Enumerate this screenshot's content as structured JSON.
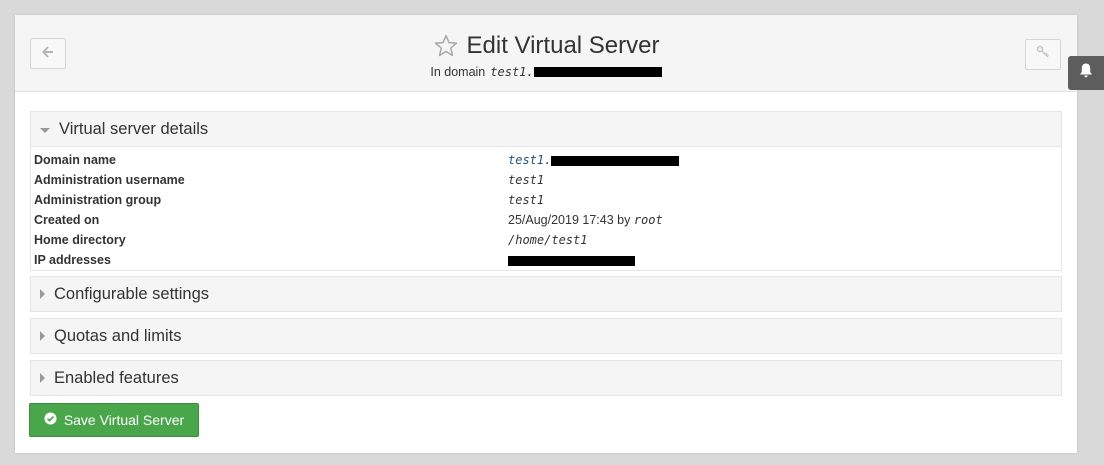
{
  "header": {
    "title": "Edit Virtual Server",
    "subtitle_label": "In domain",
    "subtitle_domain": "test1."
  },
  "sections": {
    "details": {
      "title": "Virtual server details",
      "rows": [
        {
          "label": "Domain name",
          "value": "test1."
        },
        {
          "label": "Administration username",
          "value": "test1"
        },
        {
          "label": "Administration group",
          "value": "test1"
        },
        {
          "label": "Created on",
          "value_date": "25/Aug/2019 17:43 by",
          "value_user": "root"
        },
        {
          "label": "Home directory",
          "value": "/home/test1"
        },
        {
          "label": "IP addresses",
          "value": ""
        }
      ]
    },
    "configurable": {
      "title": "Configurable settings"
    },
    "quotas": {
      "title": "Quotas and limits"
    },
    "features": {
      "title": "Enabled features"
    }
  },
  "actions": {
    "save_label": "Save Virtual Server"
  },
  "colors": {
    "save_button": "#4aa64a",
    "link": "#23527c",
    "notification_tab": "#5d5d5d"
  },
  "icons": [
    "arrow-left-icon",
    "star-icon",
    "key-icon",
    "bell-icon",
    "check-circle-icon"
  ]
}
